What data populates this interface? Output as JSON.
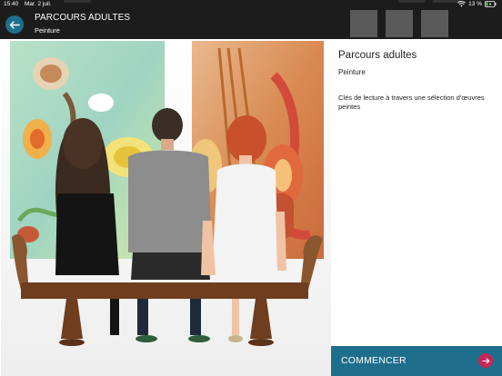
{
  "status_bar": {
    "time": "15:40",
    "date": "Mar. 2 juil.",
    "battery": "13 %"
  },
  "header": {
    "title": "PARCOURS ADULTES",
    "subtitle": "Peinture"
  },
  "panel": {
    "title": "Parcours adultes",
    "subtitle": "Peinture",
    "description": "Clés de lecture à travers une sélection d'œuvres peintes",
    "cta_label": "COMMENCER"
  },
  "colors": {
    "accent": "#1f6e8c",
    "cta_arrow": "#c8265a",
    "header_bg": "#1c1c1c"
  },
  "icons": {
    "back": "arrow-left-icon",
    "cta": "arrow-right-icon",
    "wifi": "wifi-icon",
    "battery": "battery-icon"
  }
}
